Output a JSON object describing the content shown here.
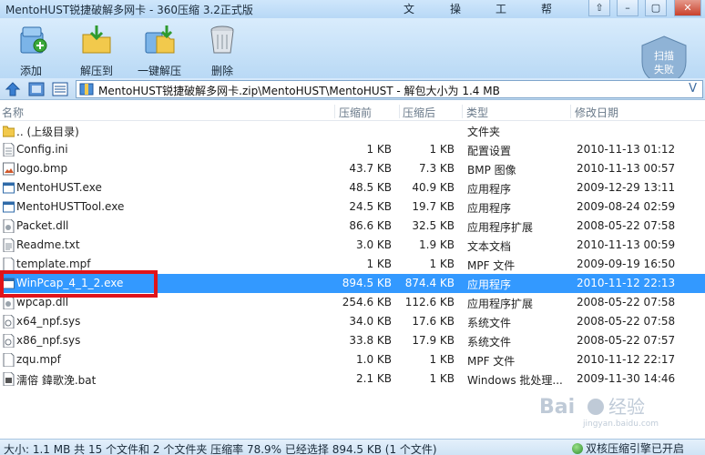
{
  "window": {
    "title": "MentoHUST锐捷破解多网卡 - 360压缩 3.2正式版",
    "menu": [
      "文件",
      "操作",
      "工具",
      "帮助"
    ],
    "controls": [
      "⇧",
      "–",
      "▢",
      "✕"
    ]
  },
  "toolbar": {
    "buttons": [
      {
        "label": "添加",
        "icon": "add-icon"
      },
      {
        "label": "解压到",
        "icon": "extract-to-icon"
      },
      {
        "label": "一键解压",
        "icon": "one-click-extract-icon"
      },
      {
        "label": "删除",
        "icon": "delete-icon"
      }
    ],
    "scan_badge": {
      "line1": "扫描",
      "line2": "失败"
    }
  },
  "address": {
    "path": "MentoHUST锐捷破解多网卡.zip\\MentoHUST\\MentoHUST - 解包大小为 1.4 MB",
    "dropdown": "V"
  },
  "columns": [
    "名称",
    "压缩前",
    "压缩后",
    "类型",
    "修改日期"
  ],
  "files": [
    {
      "name": ".. (上级目录)",
      "orig": "",
      "comp": "",
      "type": "文件夹",
      "date": "",
      "icon": "folder-icon"
    },
    {
      "name": "Config.ini",
      "orig": "1 KB",
      "comp": "1 KB",
      "type": "配置设置",
      "date": "2010-11-13 01:12",
      "icon": "ini-file-icon"
    },
    {
      "name": "logo.bmp",
      "orig": "43.7 KB",
      "comp": "7.3 KB",
      "type": "BMP 图像",
      "date": "2010-11-13 00:57",
      "icon": "image-file-icon"
    },
    {
      "name": "MentoHUST.exe",
      "orig": "48.5 KB",
      "comp": "40.9 KB",
      "type": "应用程序",
      "date": "2009-12-29 13:11",
      "icon": "exe-file-icon"
    },
    {
      "name": "MentoHUSTTool.exe",
      "orig": "24.5 KB",
      "comp": "19.7 KB",
      "type": "应用程序",
      "date": "2009-08-24 02:59",
      "icon": "exe-file-icon"
    },
    {
      "name": "Packet.dll",
      "orig": "86.6 KB",
      "comp": "32.5 KB",
      "type": "应用程序扩展",
      "date": "2008-05-22 07:58",
      "icon": "dll-file-icon"
    },
    {
      "name": "Readme.txt",
      "orig": "3.0 KB",
      "comp": "1.9 KB",
      "type": "文本文档",
      "date": "2010-11-13 00:59",
      "icon": "text-file-icon"
    },
    {
      "name": "template.mpf",
      "orig": "1 KB",
      "comp": "1 KB",
      "type": "MPF 文件",
      "date": "2009-09-19 16:50",
      "icon": "file-icon"
    },
    {
      "name": "WinPcap_4_1_2.exe",
      "orig": "894.5 KB",
      "comp": "874.4 KB",
      "type": "应用程序",
      "date": "2010-11-12 22:13",
      "icon": "exe-file-icon",
      "selected": true
    },
    {
      "name": "wpcap.dll",
      "orig": "254.6 KB",
      "comp": "112.6 KB",
      "type": "应用程序扩展",
      "date": "2008-05-22 07:58",
      "icon": "dll-file-icon"
    },
    {
      "name": "x64_npf.sys",
      "orig": "34.0 KB",
      "comp": "17.6 KB",
      "type": "系统文件",
      "date": "2008-05-22 07:58",
      "icon": "sys-file-icon"
    },
    {
      "name": "x86_npf.sys",
      "orig": "33.8 KB",
      "comp": "17.9 KB",
      "type": "系统文件",
      "date": "2008-05-22 07:57",
      "icon": "sys-file-icon"
    },
    {
      "name": "zqu.mpf",
      "orig": "1.0 KB",
      "comp": "1 KB",
      "type": "MPF 文件",
      "date": "2010-11-12 22:17",
      "icon": "file-icon"
    },
    {
      "name": "濡傛 鍏歌浼.bat",
      "orig": "2.1 KB",
      "comp": "1 KB",
      "type": "Windows 批处理...",
      "date": "2009-11-30 14:46",
      "icon": "bat-file-icon"
    }
  ],
  "status": {
    "text": "大小: 1.1 MB 共 15 个文件和 2 个文件夹 压缩率 78.9% 已经选择 894.5 KB (1 个文件)",
    "engine": "双核压缩引擎已开启"
  },
  "watermark": {
    "brand": "Bai",
    "brand2": "经验",
    "url": "jingyan.baidu.com"
  },
  "colors": {
    "selection": "#3399ff",
    "highlight_border": "#e0141b",
    "toolbar_top": "#d9ecfc",
    "toolbar_bottom": "#b9d9f5"
  }
}
